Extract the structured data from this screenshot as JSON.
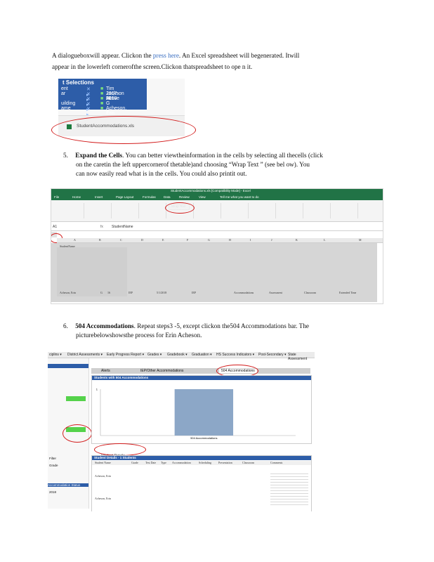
{
  "intro": {
    "line1_a": "A dialogueboxwill   appear.  Clickon  the  ",
    "line1_link": "press here",
    "line1_b": ". An Excel spreadsheet   will begenerated.   Itwill",
    "line2": "appear   in  the lowerleft   cornerofthe   screen.Clickon   thatspreadsheet      to  ope     n it."
  },
  "screenshot1": {
    "header": "t Selections",
    "rows": [
      {
        "label": "ent",
        "value": "Tim Jackson HI"
      },
      {
        "label": "ar",
        "value": "2017-2018"
      },
      {
        "label": "",
        "value": "Active"
      },
      {
        "label": "uilding",
        "value": "G"
      },
      {
        "label": "ame",
        "value": "Acheson, Erin"
      }
    ],
    "file_label": "StudentAccommodations.xls"
  },
  "step5": {
    "number": "5.",
    "title": "Expand  the Cells",
    "line1": ". You can better  viewtheinformation       in the  cells  by selecting   all thecells   (click",
    "line2": "on  the caretin  the left uppercornerof     thetable)and      choosing       “Wrap  Text ” (see  bel ow).  You",
    "line3": "can  now  easily  read  what  is in the  cells.  You  could  also  printit   out."
  },
  "excel": {
    "titlebar": "StudentAccommodations.xls [Compatibility Mode] - Excel",
    "tabs": [
      "File",
      "Home",
      "Insert",
      "Page Layout",
      "Formulas",
      "Data",
      "Review",
      "View",
      "Tell me what you want to do"
    ],
    "cell_ref": "A1",
    "formula": "StudentName",
    "columns": [
      "A",
      "B",
      "C",
      "D",
      "E",
      "F",
      "G",
      "H",
      "I",
      "J",
      "K",
      "L",
      "M"
    ],
    "wrap_text": "Wrap Text",
    "row_label": "StudentName",
    "student_cell": "Acheson, Erin",
    "data_cells": [
      "G",
      "16",
      "IEP",
      "5/1/2018",
      "IEP",
      "Accommodations",
      "Assessment",
      "Classroom",
      "Extended Time"
    ]
  },
  "step6": {
    "number": "6.",
    "title": "504  Accommodations",
    "line1": ". Repeat  steps3   -5, except   clickon  the504    Accommodations       bar.   The",
    "line2": "picturebelowshowsthe             process     for Erin  Acheson."
  },
  "app": {
    "nav": [
      "ciplins ▾",
      "District Assessments ▾",
      "Early Progress Report ▾",
      "Grades ▾",
      "Gradebook ▾",
      "Graduation ▾",
      "HS Success Indicators ▾",
      "Post-Secondary ▾",
      "State Assessment"
    ],
    "tabs": [
      "Alerts",
      "IEP/Other Accommodations",
      "504 Accommodations"
    ],
    "chart_title": "Students with 504 Accommodations",
    "table_title": "Student Details - 1 Students",
    "export_label": "Student Details",
    "student_name": "Acheson, Erin",
    "student_name2": "Acheson, Erin",
    "columns": [
      "Student Name",
      "Grade",
      "Test Date",
      "Type",
      "Accommodation",
      "Setting",
      "Timing",
      "Scheduling",
      "Presentation",
      "Response",
      "Other",
      "Subject",
      "Classroom",
      "Comments"
    ],
    "side_items": [
      "Name",
      "Grade",
      "Test",
      "Level",
      "Type",
      "G",
      "504",
      "IEP",
      "Both",
      "None",
      "Total"
    ],
    "left_labels": [
      "Filter",
      "Grade",
      "Accommodation Status",
      "2018"
    ]
  },
  "chart_data": {
    "type": "bar",
    "categories": [
      "504 Accommodations"
    ],
    "values": [
      1
    ],
    "ylim": [
      0,
      1
    ],
    "y_ticks": [
      "1",
      ""
    ],
    "title": "Students with 504 Accommodations"
  }
}
